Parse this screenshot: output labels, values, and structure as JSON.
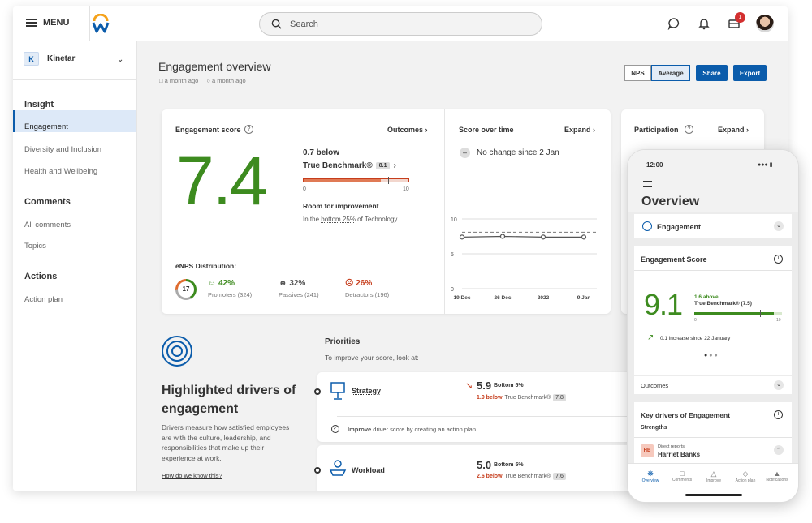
{
  "topbar": {
    "menu_label": "MENU",
    "search_placeholder": "Search",
    "notif_count": "1"
  },
  "sidebar": {
    "org_initial": "K",
    "org_name": "Kinetar",
    "sections": [
      {
        "title": "Insight",
        "items": [
          "Engagement",
          "Diversity and Inclusion",
          "Health and Wellbeing"
        ]
      },
      {
        "title": "Comments",
        "items": [
          "All comments",
          "Topics"
        ]
      },
      {
        "title": "Actions",
        "items": [
          "Action plan"
        ]
      }
    ]
  },
  "header": {
    "title": "Engagement overview",
    "meta_updated": "a month ago",
    "meta_comments": "a month ago",
    "seg_nps": "NPS",
    "seg_average": "Average",
    "share": "Share",
    "export": "Export"
  },
  "engagement": {
    "label": "Engagement score",
    "outcomes": "Outcomes",
    "score": "7.4",
    "below": "0.7 below",
    "benchmark_label": "True Benchmark®",
    "benchmark_value": "8.1",
    "scale_min": "0",
    "scale_max": "10",
    "benchmark_fraction": 0.81,
    "score_fraction": 0.74,
    "room": "Room for improvement",
    "room_detail_pre": "In the ",
    "room_detail_link": "bottom 25%",
    "room_detail_post": " of Technology",
    "enps_label": "eNPS Distribution:",
    "enps_value": "17",
    "promoters_pct": "42%",
    "promoters_label": "Promoters (324)",
    "passives_pct": "32%",
    "passives_label": "Passives (241)",
    "detractors_pct": "26%",
    "detractors_label": "Detractors (196)"
  },
  "score_over_time": {
    "label": "Score over time",
    "expand": "Expand",
    "status": "No change since 2 Jan"
  },
  "chart_data": {
    "type": "line",
    "x": [
      "19 Dec",
      "26 Dec",
      "2022",
      "9 Jan"
    ],
    "series": [
      {
        "values": [
          7.4,
          7.5,
          7.4,
          7.4
        ]
      }
    ],
    "benchmark": 8.1,
    "yticks": [
      "10",
      "5",
      "0"
    ],
    "ylim": [
      0,
      10
    ]
  },
  "participation": {
    "label": "Participation",
    "expand": "Expand"
  },
  "drivers": {
    "title": "Highlighted drivers of engagement",
    "body": "Drivers measure how satisfied employees are with the culture, leadership, and responsibilities that make up their experience at work.",
    "link": "How do we know this?"
  },
  "priorities": {
    "title": "Priorities",
    "subtitle": "To improve your score, look at:",
    "items": [
      {
        "name": "Strategy",
        "score": "5.9",
        "rank": "Bottom 5%",
        "below": "1.9 below",
        "bench": "True Benchmark®",
        "bench_value": "7.8",
        "action_bold": "Improve",
        "action_rest": " driver score by creating an action plan"
      },
      {
        "name": "Workload",
        "score": "5.0",
        "rank": "Bottom 5%",
        "below": "2.6 below",
        "bench": "True Benchmark®",
        "bench_value": "7.6"
      }
    ]
  },
  "phone": {
    "time": "12:00",
    "title": "Overview",
    "section": "Engagement",
    "score_label": "Engagement Score",
    "score": "9.1",
    "above": "1.6 above",
    "benchmark": "True Benchmark® (7.5)",
    "scale_min": "0",
    "scale_max": "10",
    "score_fraction": 0.91,
    "benchmark_fraction": 0.75,
    "increase": "0.1 increase since 22 January",
    "outcomes": "Outcomes",
    "key_drivers": "Key drivers of Engagement",
    "strengths": "Strengths",
    "person_initials": "HB",
    "person_role": "Direct reports",
    "person_name": "Harriet Banks",
    "nav": [
      "Overview",
      "Comments",
      "Improve",
      "Action plan",
      "Notifications"
    ]
  },
  "colors": {
    "accent": "#0b5cab",
    "score_green": "#3d8b1f",
    "red": "#c63d1c"
  }
}
